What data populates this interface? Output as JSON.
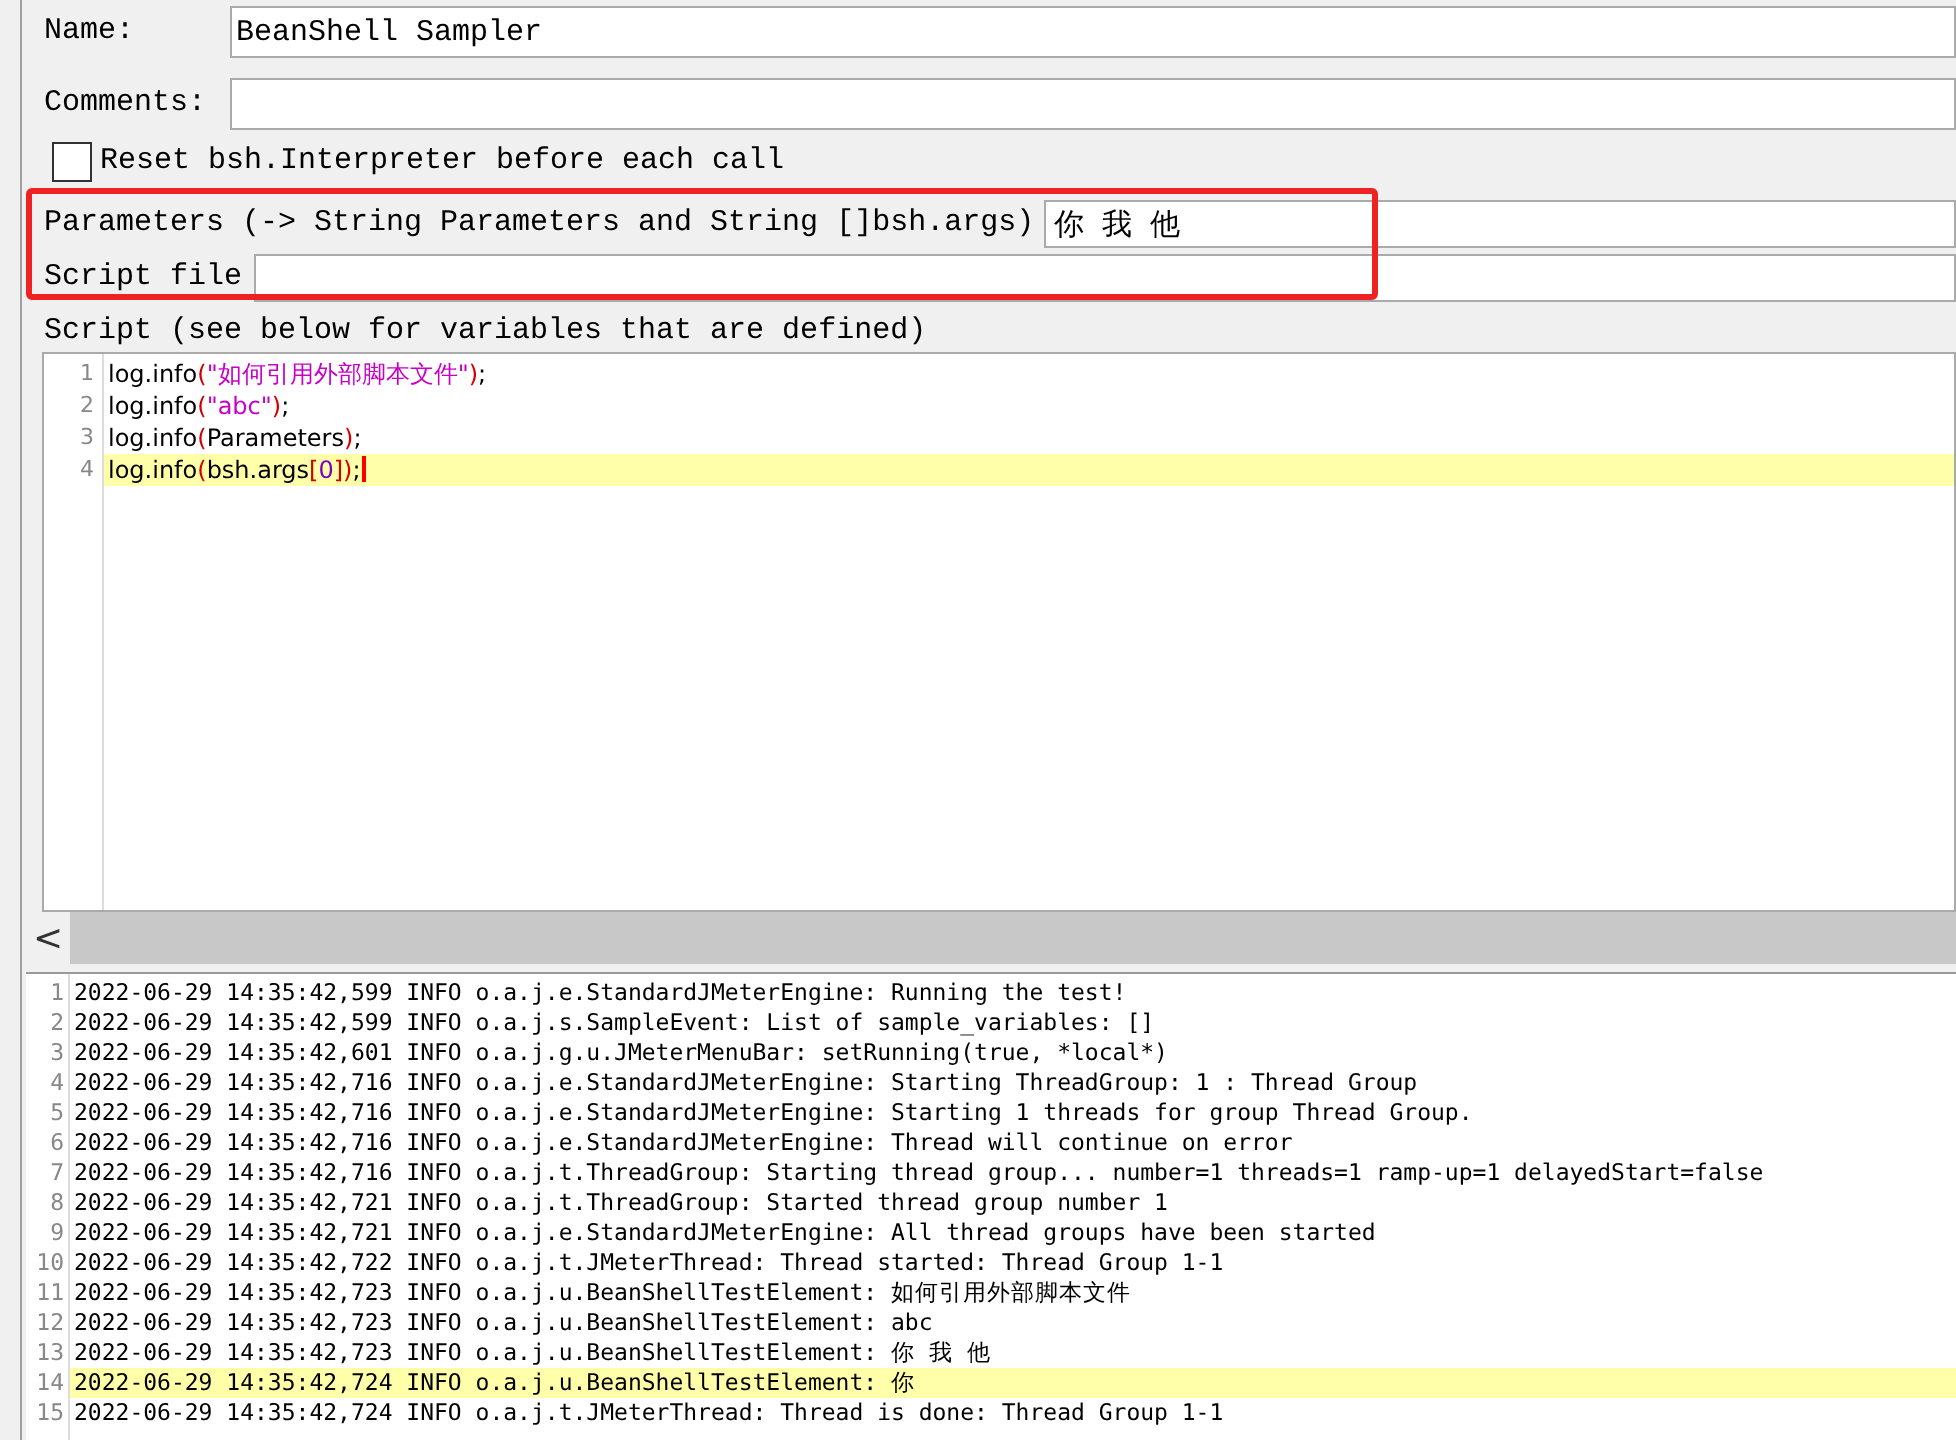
{
  "name_field": {
    "label": "Name:",
    "value": "BeanShell Sampler"
  },
  "comments_field": {
    "label": "Comments:"
  },
  "reset_option": {
    "label": "Reset bsh.Interpreter before each call",
    "checked": false
  },
  "parameters_field": {
    "label": "Parameters (-> String Parameters and String []bsh.args)",
    "value": "你 我 他"
  },
  "script_file_field": {
    "label": "Script file"
  },
  "script_label": "Script (see below for variables that are defined)",
  "script_lines": [
    {
      "number": "1",
      "selected": false,
      "tokens": [
        {
          "kind": "plain",
          "text": "log.info"
        },
        {
          "kind": "paren",
          "text": "("
        },
        {
          "kind": "string",
          "text": "\"如何引用外部脚本文件\""
        },
        {
          "kind": "paren",
          "text": ")"
        },
        {
          "kind": "plain",
          "text": ";"
        }
      ]
    },
    {
      "number": "2",
      "selected": false,
      "tokens": [
        {
          "kind": "plain",
          "text": "log.info"
        },
        {
          "kind": "paren",
          "text": "("
        },
        {
          "kind": "string",
          "text": "\"abc\""
        },
        {
          "kind": "paren",
          "text": ")"
        },
        {
          "kind": "plain",
          "text": ";"
        }
      ]
    },
    {
      "number": "3",
      "selected": false,
      "tokens": [
        {
          "kind": "plain",
          "text": "log.info"
        },
        {
          "kind": "paren",
          "text": "("
        },
        {
          "kind": "plain",
          "text": "Parameters"
        },
        {
          "kind": "paren",
          "text": ")"
        },
        {
          "kind": "plain",
          "text": ";"
        }
      ]
    },
    {
      "number": "4",
      "selected": true,
      "tokens": [
        {
          "kind": "plain",
          "text": "log.info"
        },
        {
          "kind": "paren",
          "text": "("
        },
        {
          "kind": "plain",
          "text": "bsh.args"
        },
        {
          "kind": "paren",
          "text": "["
        },
        {
          "kind": "number",
          "text": "0"
        },
        {
          "kind": "paren",
          "text": "])"
        },
        {
          "kind": "plain",
          "text": ";"
        }
      ]
    }
  ],
  "scroll_left": "<",
  "log_lines": [
    {
      "number": "1",
      "selected": false,
      "text": "2022-06-29 14:35:42,599 INFO o.a.j.e.StandardJMeterEngine: Running the test!"
    },
    {
      "number": "2",
      "selected": false,
      "text": "2022-06-29 14:35:42,599 INFO o.a.j.s.SampleEvent: List of sample_variables: []"
    },
    {
      "number": "3",
      "selected": false,
      "text": "2022-06-29 14:35:42,601 INFO o.a.j.g.u.JMeterMenuBar: setRunning(true, *local*)"
    },
    {
      "number": "4",
      "selected": false,
      "text": "2022-06-29 14:35:42,716 INFO o.a.j.e.StandardJMeterEngine: Starting ThreadGroup: 1 : Thread Group"
    },
    {
      "number": "5",
      "selected": false,
      "text": "2022-06-29 14:35:42,716 INFO o.a.j.e.StandardJMeterEngine: Starting 1 threads for group Thread Group."
    },
    {
      "number": "6",
      "selected": false,
      "text": "2022-06-29 14:35:42,716 INFO o.a.j.e.StandardJMeterEngine: Thread will continue on error"
    },
    {
      "number": "7",
      "selected": false,
      "text": "2022-06-29 14:35:42,716 INFO o.a.j.t.ThreadGroup: Starting thread group... number=1 threads=1 ramp-up=1 delayedStart=false"
    },
    {
      "number": "8",
      "selected": false,
      "text": "2022-06-29 14:35:42,721 INFO o.a.j.t.ThreadGroup: Started thread group number 1"
    },
    {
      "number": "9",
      "selected": false,
      "text": "2022-06-29 14:35:42,721 INFO o.a.j.e.StandardJMeterEngine: All thread groups have been started"
    },
    {
      "number": "10",
      "selected": false,
      "text": "2022-06-29 14:35:42,722 INFO o.a.j.t.JMeterThread: Thread started: Thread Group 1-1"
    },
    {
      "number": "11",
      "selected": false,
      "text": "2022-06-29 14:35:42,723 INFO o.a.j.u.BeanShellTestElement: 如何引用外部脚本文件"
    },
    {
      "number": "12",
      "selected": false,
      "text": "2022-06-29 14:35:42,723 INFO o.a.j.u.BeanShellTestElement: abc"
    },
    {
      "number": "13",
      "selected": false,
      "text": "2022-06-29 14:35:42,723 INFO o.a.j.u.BeanShellTestElement: 你 我 他"
    },
    {
      "number": "14",
      "selected": true,
      "text": "2022-06-29 14:35:42,724 INFO o.a.j.u.BeanShellTestElement: 你"
    },
    {
      "number": "15",
      "selected": false,
      "text": "2022-06-29 14:35:42,724 INFO o.a.j.t.JMeterThread: Thread is done: Thread Group 1-1"
    }
  ]
}
